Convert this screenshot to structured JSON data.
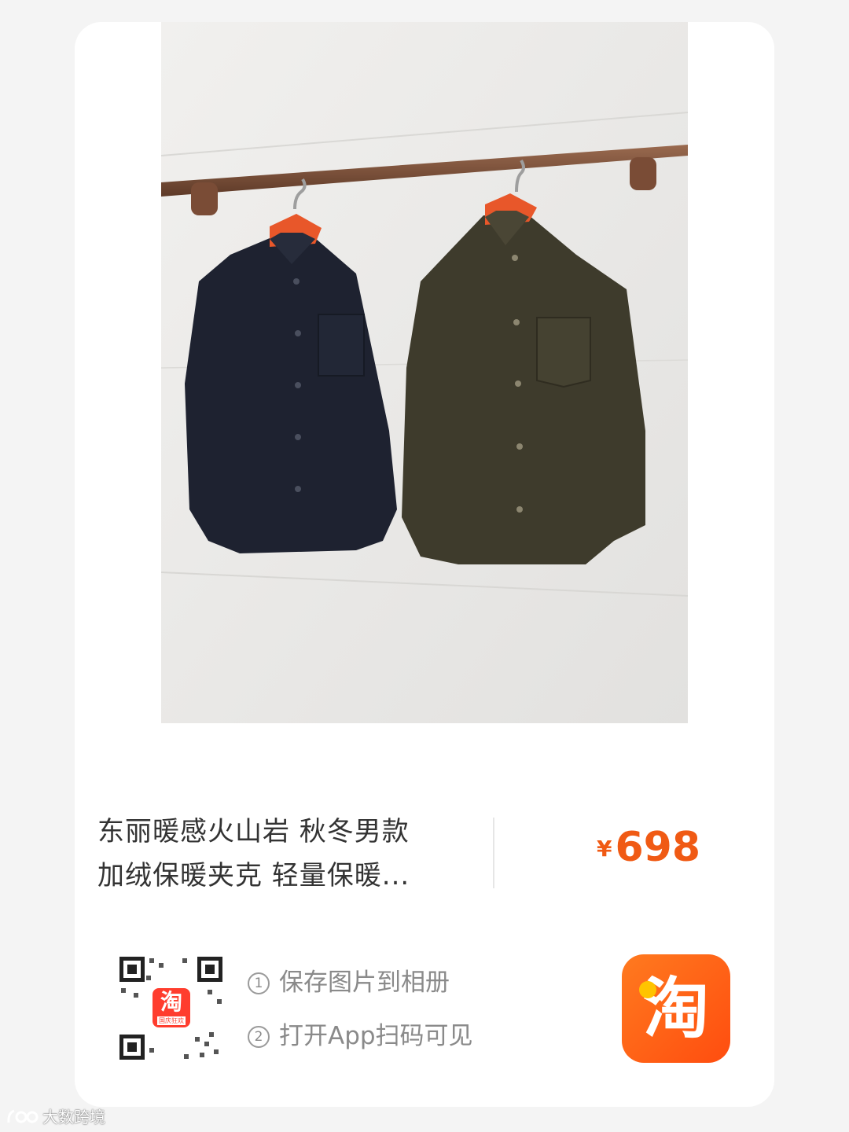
{
  "product": {
    "title_line1": "东丽暖感火山岩 秋冬男款",
    "title_line2": "加绒保暖夹克 轻量保暖...",
    "price_symbol": "¥",
    "price": "698"
  },
  "share": {
    "step1": "保存图片到相册",
    "step2": "打开App扫码可见",
    "step1_marker": "1",
    "step2_marker": "2",
    "qr_badge_char": "淘",
    "qr_badge_text": "国庆狂欢"
  },
  "app": {
    "logo_char": "淘",
    "logo_icon": "taobao-logo"
  },
  "watermark": {
    "text": "大数跨境"
  },
  "colors": {
    "accent": "#f05a14",
    "taobao_orange": "#ff5a0f",
    "card_bg": "#ffffff",
    "page_bg": "#f4f4f4",
    "text": "#333333",
    "muted": "#8a8a8a"
  }
}
